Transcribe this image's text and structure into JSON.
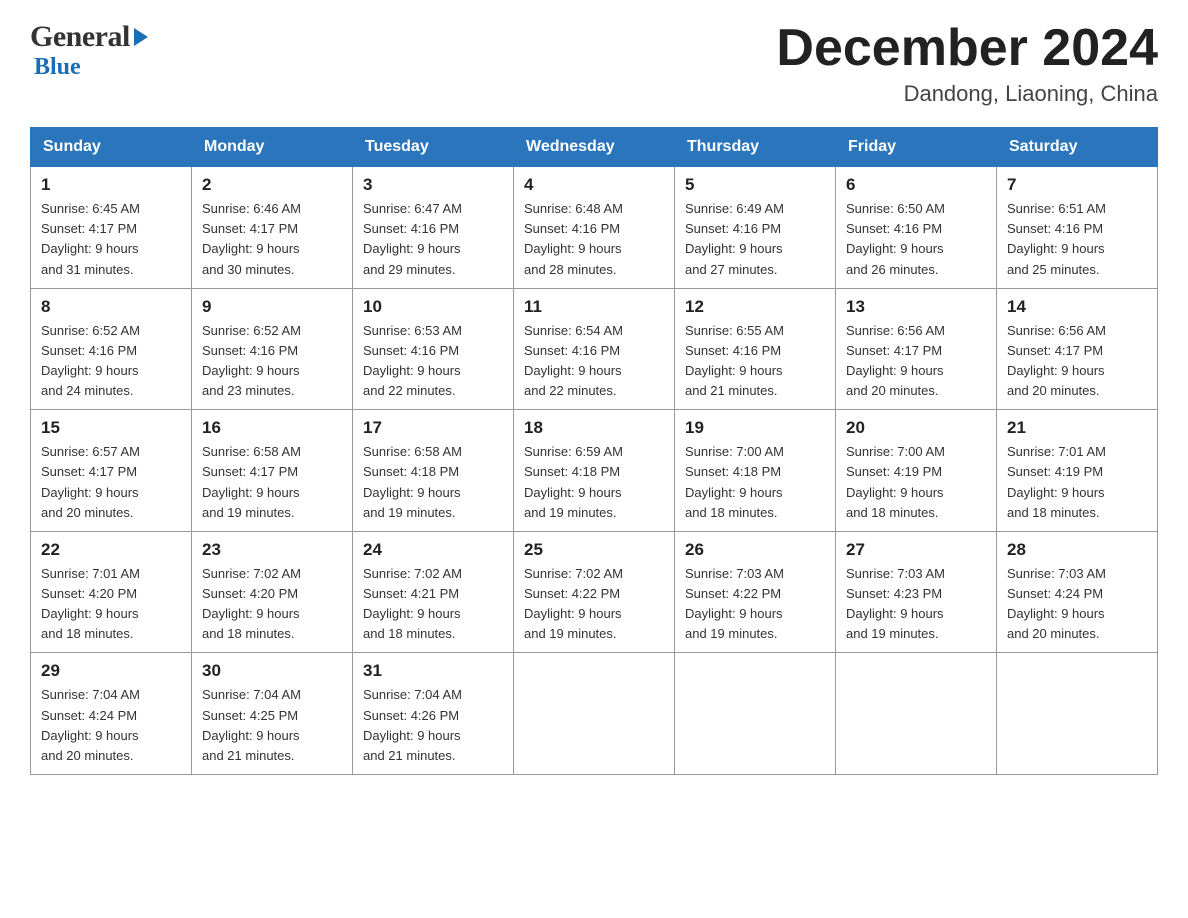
{
  "header": {
    "logo_general": "General",
    "logo_arrow": "▶",
    "logo_blue": "Blue",
    "month_year": "December 2024",
    "location": "Dandong, Liaoning, China"
  },
  "days_of_week": [
    "Sunday",
    "Monday",
    "Tuesday",
    "Wednesday",
    "Thursday",
    "Friday",
    "Saturday"
  ],
  "weeks": [
    [
      {
        "day": "1",
        "sunrise": "6:45 AM",
        "sunset": "4:17 PM",
        "daylight": "9 hours and 31 minutes."
      },
      {
        "day": "2",
        "sunrise": "6:46 AM",
        "sunset": "4:17 PM",
        "daylight": "9 hours and 30 minutes."
      },
      {
        "day": "3",
        "sunrise": "6:47 AM",
        "sunset": "4:16 PM",
        "daylight": "9 hours and 29 minutes."
      },
      {
        "day": "4",
        "sunrise": "6:48 AM",
        "sunset": "4:16 PM",
        "daylight": "9 hours and 28 minutes."
      },
      {
        "day": "5",
        "sunrise": "6:49 AM",
        "sunset": "4:16 PM",
        "daylight": "9 hours and 27 minutes."
      },
      {
        "day": "6",
        "sunrise": "6:50 AM",
        "sunset": "4:16 PM",
        "daylight": "9 hours and 26 minutes."
      },
      {
        "day": "7",
        "sunrise": "6:51 AM",
        "sunset": "4:16 PM",
        "daylight": "9 hours and 25 minutes."
      }
    ],
    [
      {
        "day": "8",
        "sunrise": "6:52 AM",
        "sunset": "4:16 PM",
        "daylight": "9 hours and 24 minutes."
      },
      {
        "day": "9",
        "sunrise": "6:52 AM",
        "sunset": "4:16 PM",
        "daylight": "9 hours and 23 minutes."
      },
      {
        "day": "10",
        "sunrise": "6:53 AM",
        "sunset": "4:16 PM",
        "daylight": "9 hours and 22 minutes."
      },
      {
        "day": "11",
        "sunrise": "6:54 AM",
        "sunset": "4:16 PM",
        "daylight": "9 hours and 22 minutes."
      },
      {
        "day": "12",
        "sunrise": "6:55 AM",
        "sunset": "4:16 PM",
        "daylight": "9 hours and 21 minutes."
      },
      {
        "day": "13",
        "sunrise": "6:56 AM",
        "sunset": "4:17 PM",
        "daylight": "9 hours and 20 minutes."
      },
      {
        "day": "14",
        "sunrise": "6:56 AM",
        "sunset": "4:17 PM",
        "daylight": "9 hours and 20 minutes."
      }
    ],
    [
      {
        "day": "15",
        "sunrise": "6:57 AM",
        "sunset": "4:17 PM",
        "daylight": "9 hours and 20 minutes."
      },
      {
        "day": "16",
        "sunrise": "6:58 AM",
        "sunset": "4:17 PM",
        "daylight": "9 hours and 19 minutes."
      },
      {
        "day": "17",
        "sunrise": "6:58 AM",
        "sunset": "4:18 PM",
        "daylight": "9 hours and 19 minutes."
      },
      {
        "day": "18",
        "sunrise": "6:59 AM",
        "sunset": "4:18 PM",
        "daylight": "9 hours and 19 minutes."
      },
      {
        "day": "19",
        "sunrise": "7:00 AM",
        "sunset": "4:18 PM",
        "daylight": "9 hours and 18 minutes."
      },
      {
        "day": "20",
        "sunrise": "7:00 AM",
        "sunset": "4:19 PM",
        "daylight": "9 hours and 18 minutes."
      },
      {
        "day": "21",
        "sunrise": "7:01 AM",
        "sunset": "4:19 PM",
        "daylight": "9 hours and 18 minutes."
      }
    ],
    [
      {
        "day": "22",
        "sunrise": "7:01 AM",
        "sunset": "4:20 PM",
        "daylight": "9 hours and 18 minutes."
      },
      {
        "day": "23",
        "sunrise": "7:02 AM",
        "sunset": "4:20 PM",
        "daylight": "9 hours and 18 minutes."
      },
      {
        "day": "24",
        "sunrise": "7:02 AM",
        "sunset": "4:21 PM",
        "daylight": "9 hours and 18 minutes."
      },
      {
        "day": "25",
        "sunrise": "7:02 AM",
        "sunset": "4:22 PM",
        "daylight": "9 hours and 19 minutes."
      },
      {
        "day": "26",
        "sunrise": "7:03 AM",
        "sunset": "4:22 PM",
        "daylight": "9 hours and 19 minutes."
      },
      {
        "day": "27",
        "sunrise": "7:03 AM",
        "sunset": "4:23 PM",
        "daylight": "9 hours and 19 minutes."
      },
      {
        "day": "28",
        "sunrise": "7:03 AM",
        "sunset": "4:24 PM",
        "daylight": "9 hours and 20 minutes."
      }
    ],
    [
      {
        "day": "29",
        "sunrise": "7:04 AM",
        "sunset": "4:24 PM",
        "daylight": "9 hours and 20 minutes."
      },
      {
        "day": "30",
        "sunrise": "7:04 AM",
        "sunset": "4:25 PM",
        "daylight": "9 hours and 21 minutes."
      },
      {
        "day": "31",
        "sunrise": "7:04 AM",
        "sunset": "4:26 PM",
        "daylight": "9 hours and 21 minutes."
      },
      null,
      null,
      null,
      null
    ]
  ],
  "labels": {
    "sunrise": "Sunrise:",
    "sunset": "Sunset:",
    "daylight": "Daylight:"
  }
}
